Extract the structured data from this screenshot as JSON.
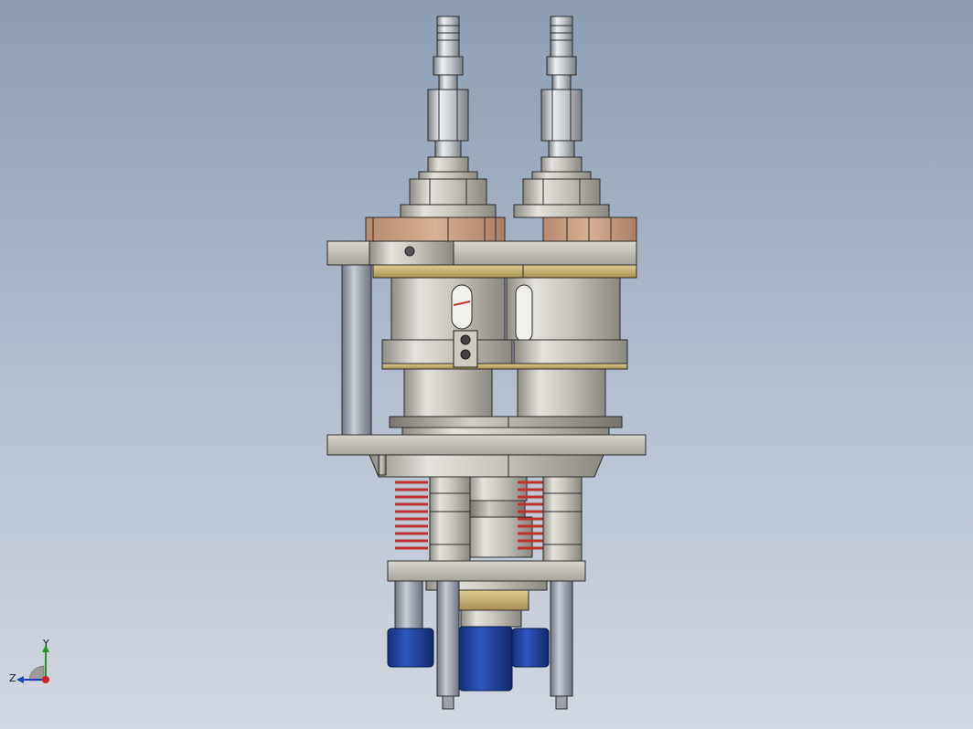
{
  "viewport": {
    "background_top": "#8c9db3",
    "background_bottom": "#d2d8e2"
  },
  "colors": {
    "steel_light": "#d8d6cf",
    "steel_mid": "#b9b6ac",
    "steel_dark": "#8d8a82",
    "bronze": "#c9a083",
    "brass": "#c8b27a",
    "spring": "#c2302a",
    "blue_cap": "#1c3f9c",
    "rod": "#9aa0aa",
    "outline": "#2b2b2b"
  },
  "triad": {
    "y_label": "Y",
    "z_label": "Z",
    "icons": [
      "y-axis-arrow-icon",
      "z-axis-arrow-icon",
      "x-axis-origin-icon"
    ]
  }
}
